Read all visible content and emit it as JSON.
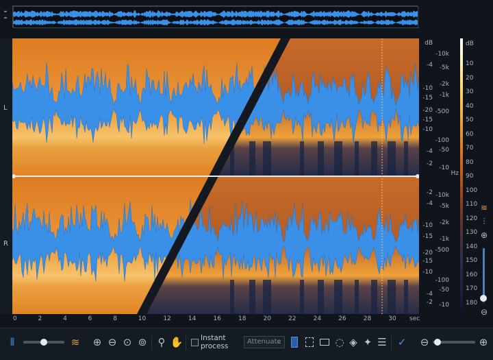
{
  "overview": {
    "collapse_icon": "chevron-down-icon",
    "expand_icon": "chevron-updown-icon"
  },
  "channels": {
    "left": "L",
    "right": "R"
  },
  "db_scale_top": [
    "dB",
    "-4",
    "-10",
    "-15",
    "-20",
    "-15",
    "-10",
    "-4",
    "-2"
  ],
  "db_scale_bottom": [
    "-2",
    "-4",
    "-10",
    "-15",
    "-20",
    "-15",
    "-10",
    "-4",
    "-2"
  ],
  "hz_scale_top": [
    "-10k",
    "-5k",
    "-2k",
    "-1k",
    "-500",
    "-100",
    "-50",
    "-10"
  ],
  "hz_unit": "Hz",
  "hz_scale_bottom": [
    "-10k",
    "-5k",
    "-2k",
    "-1k",
    "-500",
    "-100",
    "-50",
    "-10"
  ],
  "colorbar": {
    "unit": "dB",
    "labels": [
      "10",
      "20",
      "30",
      "40",
      "50",
      "60",
      "70",
      "80",
      "90",
      "100",
      "110",
      "120",
      "130",
      "140",
      "150",
      "160",
      "170",
      "180"
    ]
  },
  "time_axis": {
    "ticks": [
      "0",
      "2",
      "4",
      "6",
      "8",
      "10",
      "12",
      "14",
      "16",
      "18",
      "20",
      "22",
      "24",
      "26",
      "28",
      "30"
    ],
    "unit": "sec"
  },
  "toolbar": {
    "instant_process": "Instant process",
    "attenuate": "Attenuate"
  },
  "colors": {
    "spectrum": "#e3862a",
    "waveform": "#3a8fe6",
    "background": "#10151c"
  }
}
